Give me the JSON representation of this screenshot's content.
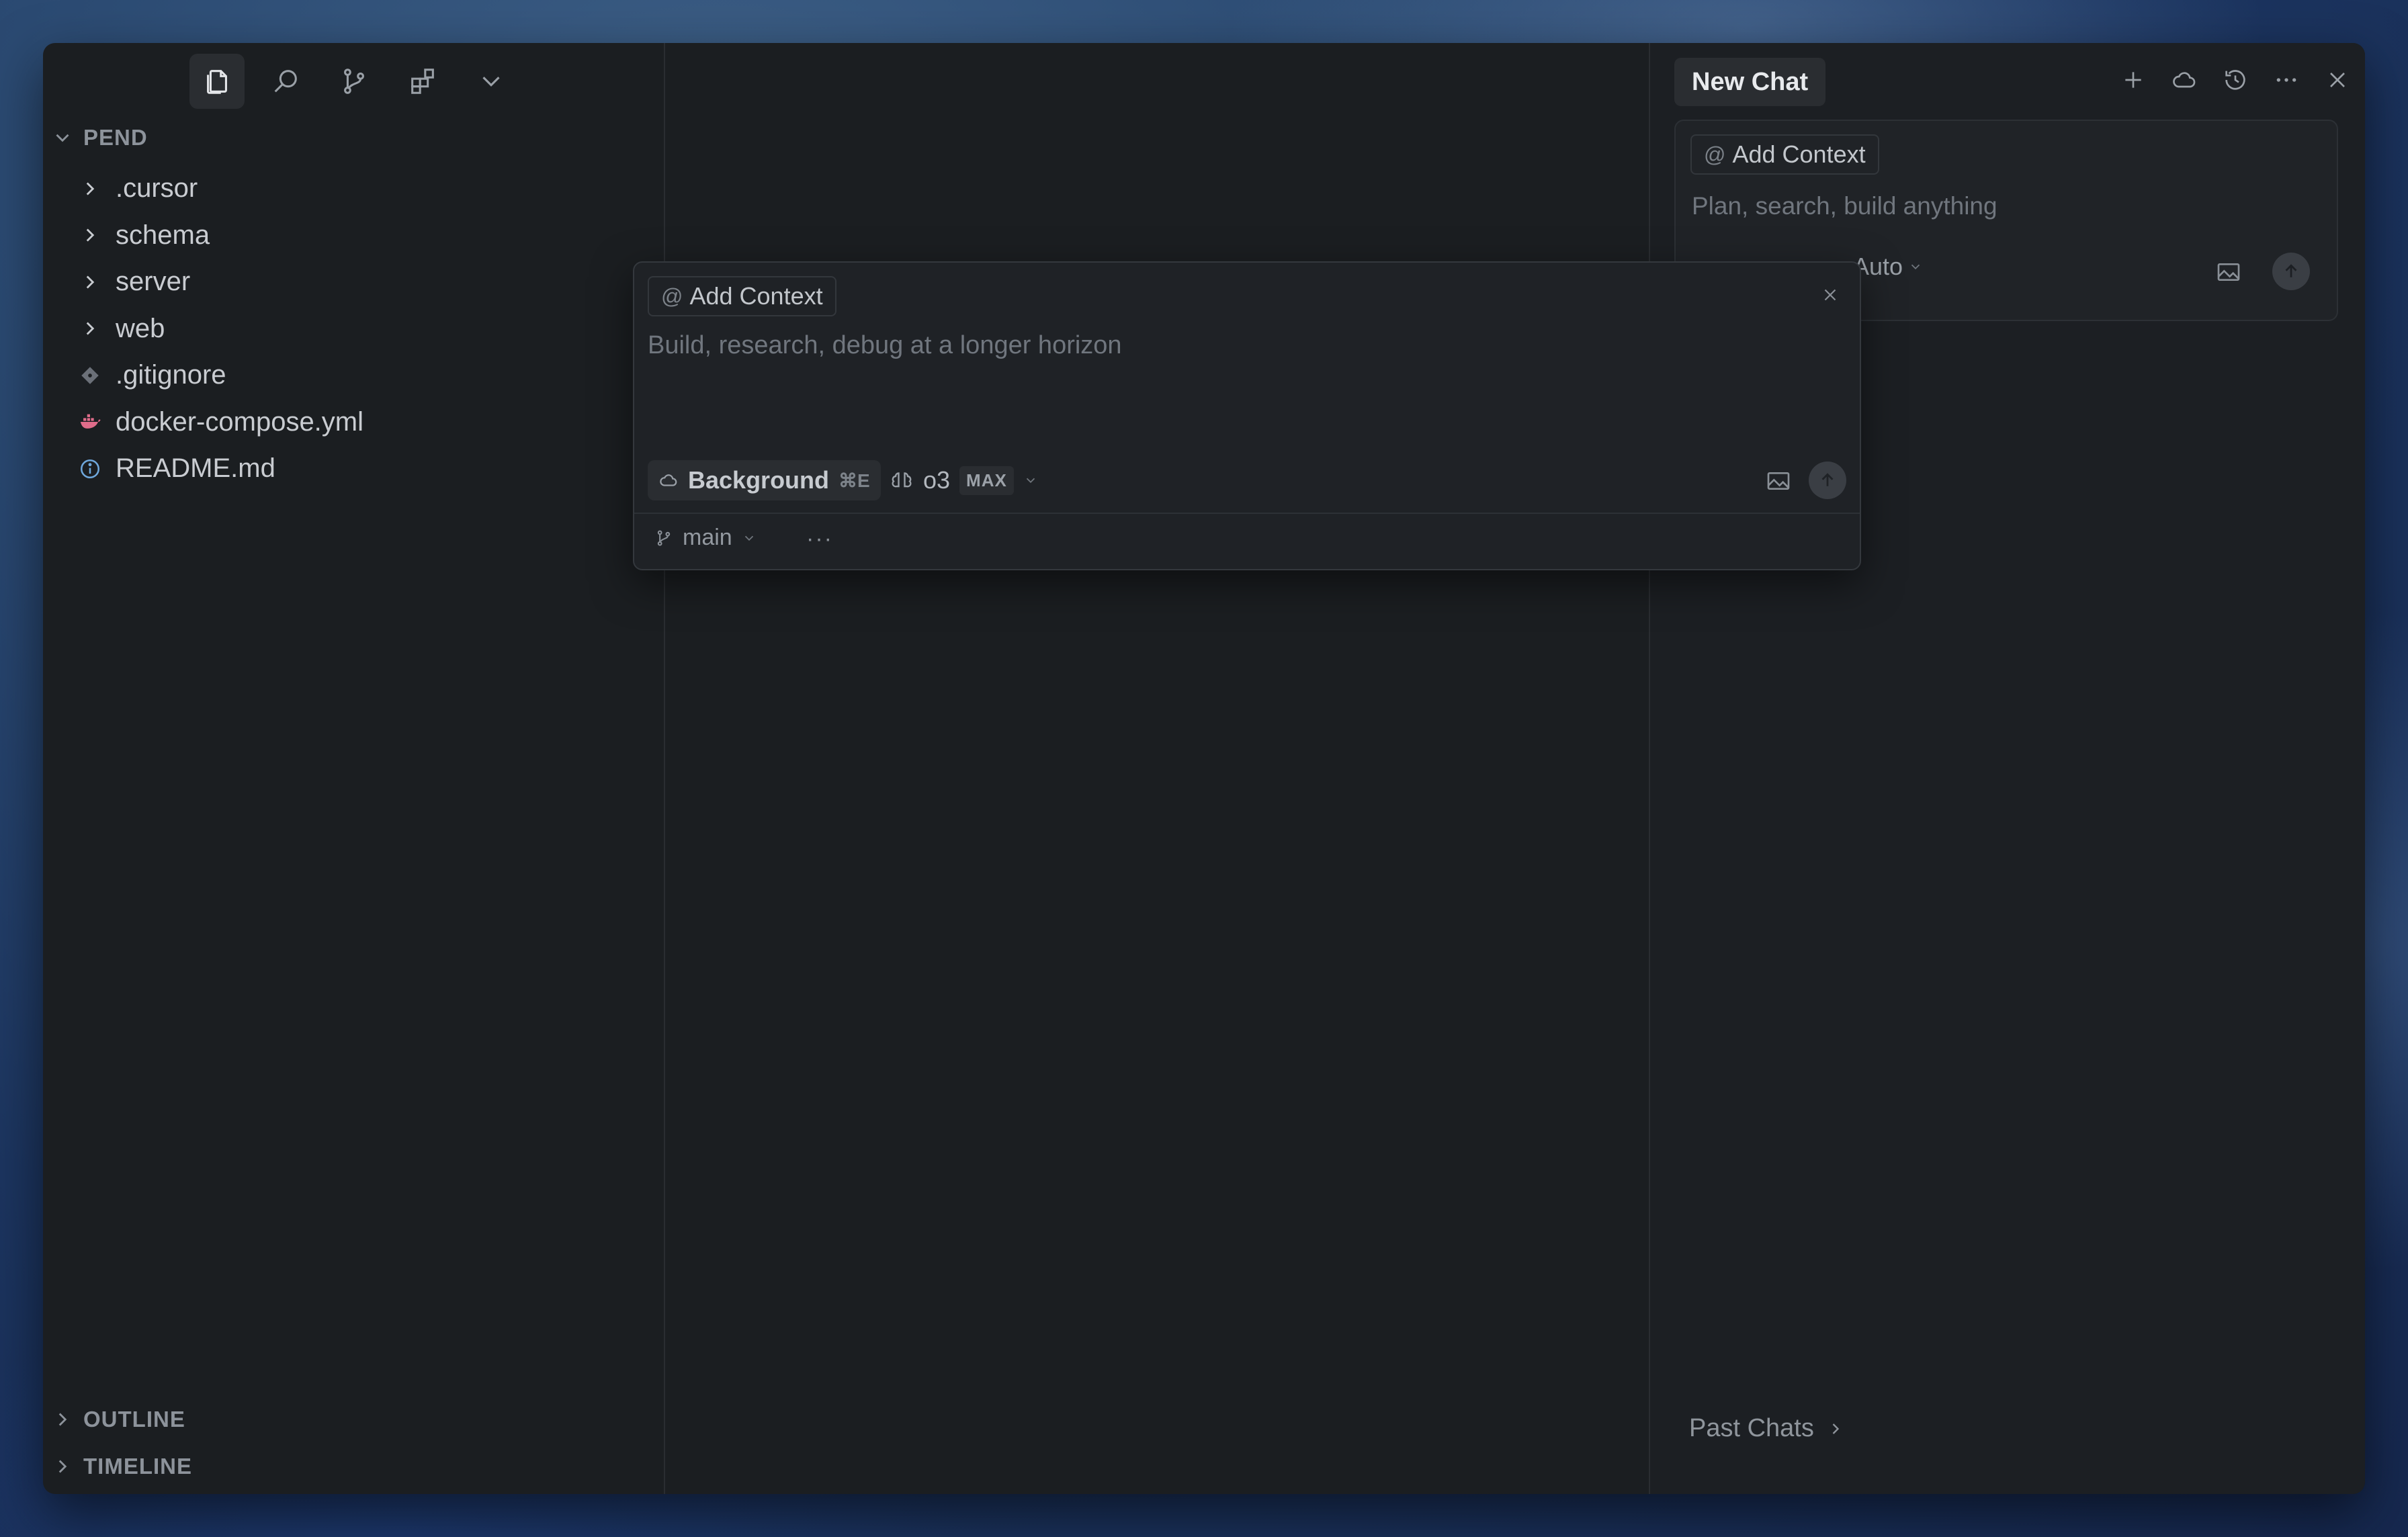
{
  "explorer": {
    "root_label": "PEND",
    "items": [
      {
        "label": ".cursor",
        "kind": "folder"
      },
      {
        "label": "schema",
        "kind": "folder"
      },
      {
        "label": "server",
        "kind": "folder"
      },
      {
        "label": "web",
        "kind": "folder"
      },
      {
        "label": ".gitignore",
        "kind": "git-file"
      },
      {
        "label": "docker-compose.yml",
        "kind": "docker-file"
      },
      {
        "label": "README.md",
        "kind": "info-file"
      }
    ],
    "outline_label": "OUTLINE",
    "timeline_label": "TIMELINE"
  },
  "toolbar": {
    "icons": [
      "files-icon",
      "search-icon",
      "source-control-icon",
      "extensions-icon",
      "chevron-down-icon"
    ]
  },
  "chat": {
    "title": "New Chat",
    "add_context": "Add Context",
    "placeholder": "Plan, search, build anything",
    "mode": "Auto",
    "past_chats": "Past Chats"
  },
  "popup": {
    "add_context": "Add Context",
    "placeholder": "Build, research, debug at a longer horizon",
    "background_label": "Background",
    "background_shortcut": "⌘E",
    "model": "o3",
    "max_badge": "MAX",
    "branch": "main",
    "more": "···"
  },
  "colors": {
    "window_bg": "#1b1e21",
    "accent_docker": "#e06c8a",
    "info_blue": "#6fa8dc"
  }
}
